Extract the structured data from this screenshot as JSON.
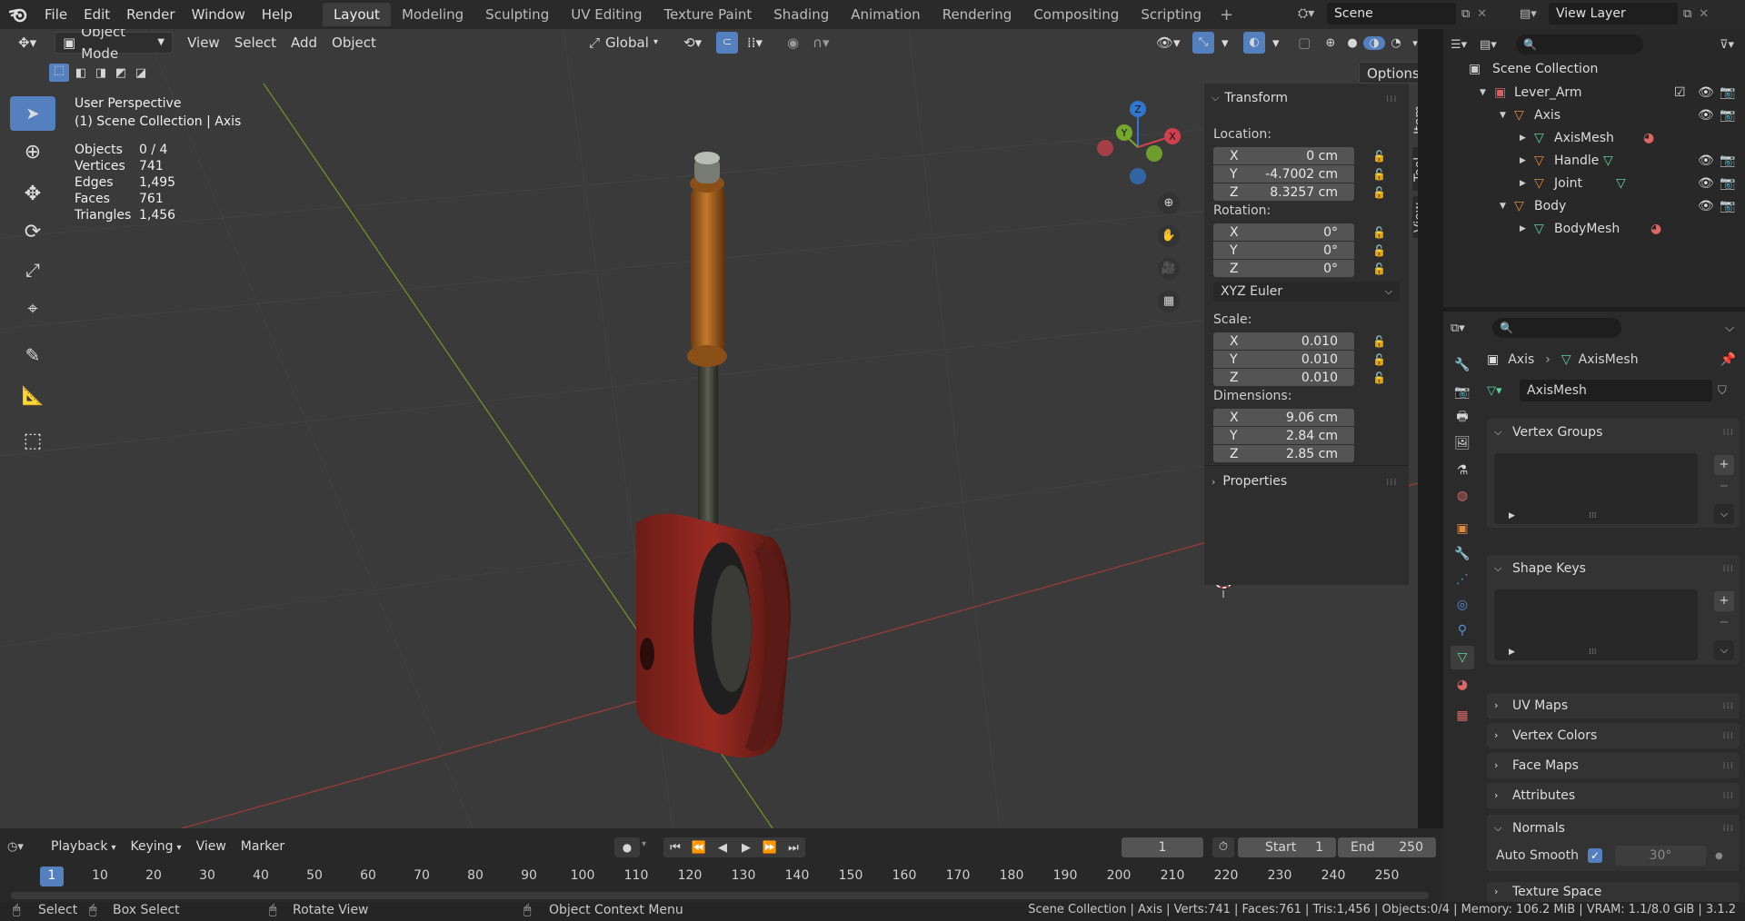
{
  "menu": [
    "File",
    "Edit",
    "Render",
    "Window",
    "Help"
  ],
  "workspaces": [
    "Layout",
    "Modeling",
    "Sculpting",
    "UV Editing",
    "Texture Paint",
    "Shading",
    "Animation",
    "Rendering",
    "Compositing",
    "Scripting"
  ],
  "active_workspace": "Layout",
  "scene": {
    "name": "Scene",
    "view_layer": "View Layer"
  },
  "viewport_header": {
    "mode": "Object Mode",
    "menus": [
      "View",
      "Select",
      "Add",
      "Object"
    ],
    "orientation": "Global",
    "options": "Options"
  },
  "viewport_info": {
    "perspective": "User Perspective",
    "context": "(1) Scene Collection | Axis",
    "stats": [
      {
        "label": "Objects",
        "value": "0 / 4"
      },
      {
        "label": "Vertices",
        "value": "741"
      },
      {
        "label": "Edges",
        "value": "1,495"
      },
      {
        "label": "Faces",
        "value": "761"
      },
      {
        "label": "Triangles",
        "value": "1,456"
      }
    ]
  },
  "gizmo": {
    "x": "X",
    "y": "Y",
    "z": "Z"
  },
  "transform": {
    "title": "Transform",
    "location_label": "Location:",
    "location": [
      {
        "axis": "X",
        "value": "0 cm"
      },
      {
        "axis": "Y",
        "value": "-4.7002 cm"
      },
      {
        "axis": "Z",
        "value": "8.3257 cm"
      }
    ],
    "rotation_label": "Rotation:",
    "rotation": [
      {
        "axis": "X",
        "value": "0°"
      },
      {
        "axis": "Y",
        "value": "0°"
      },
      {
        "axis": "Z",
        "value": "0°"
      }
    ],
    "rotation_mode": "XYZ Euler",
    "scale_label": "Scale:",
    "scale": [
      {
        "axis": "X",
        "value": "0.010"
      },
      {
        "axis": "Y",
        "value": "0.010"
      },
      {
        "axis": "Z",
        "value": "0.010"
      }
    ],
    "dimensions_label": "Dimensions:",
    "dimensions": [
      {
        "axis": "X",
        "value": "9.06 cm"
      },
      {
        "axis": "Y",
        "value": "2.84 cm"
      },
      {
        "axis": "Z",
        "value": "2.85 cm"
      }
    ],
    "properties": "Properties"
  },
  "n_tabs": [
    "Item",
    "Tool",
    "View"
  ],
  "outliner": {
    "root": "Scene Collection",
    "rows": [
      {
        "name": "Lever_Arm",
        "indent": 1
      },
      {
        "name": "Axis",
        "indent": 2
      },
      {
        "name": "AxisMesh",
        "indent": 3
      },
      {
        "name": "Handle",
        "indent": 3
      },
      {
        "name": "Joint",
        "indent": 3
      },
      {
        "name": "Body",
        "indent": 2
      },
      {
        "name": "BodyMesh",
        "indent": 3
      }
    ]
  },
  "properties": {
    "breadcrumb_object": "Axis",
    "breadcrumb_data": "AxisMesh",
    "datablock": "AxisMesh",
    "panels": [
      "Vertex Groups",
      "Shape Keys",
      "UV Maps",
      "Vertex Colors",
      "Face Maps",
      "Attributes",
      "Normals",
      "Texture Space"
    ],
    "auto_smooth_label": "Auto Smooth",
    "auto_smooth_angle": "30°"
  },
  "timeline": {
    "menus": [
      "Playback",
      "Keying",
      "View",
      "Marker"
    ],
    "current_frame": "1",
    "start_label": "Start",
    "start": "1",
    "end_label": "End",
    "end": "250",
    "ticks": [
      "1",
      "10",
      "20",
      "30",
      "40",
      "50",
      "60",
      "70",
      "80",
      "90",
      "100",
      "110",
      "120",
      "130",
      "140",
      "150",
      "160",
      "170",
      "180",
      "190",
      "200",
      "210",
      "220",
      "230",
      "240",
      "250"
    ]
  },
  "statusbar": {
    "select": "Select",
    "box_select": "Box Select",
    "rotate_view": "Rotate View",
    "context_menu": "Object Context Menu",
    "info": "Scene Collection | Axis | Verts:741 | Faces:761 | Tris:1,456 | Objects:0/4 | Memory: 106.2 MiB | VRAM: 1.1/8.0 GiB | 3.1.2"
  },
  "colors": {
    "accent": "#5480bf",
    "selected_row": "#334d80",
    "x_axis": "#d2404d",
    "y_axis": "#76a82c",
    "z_axis": "#2f77d0"
  }
}
